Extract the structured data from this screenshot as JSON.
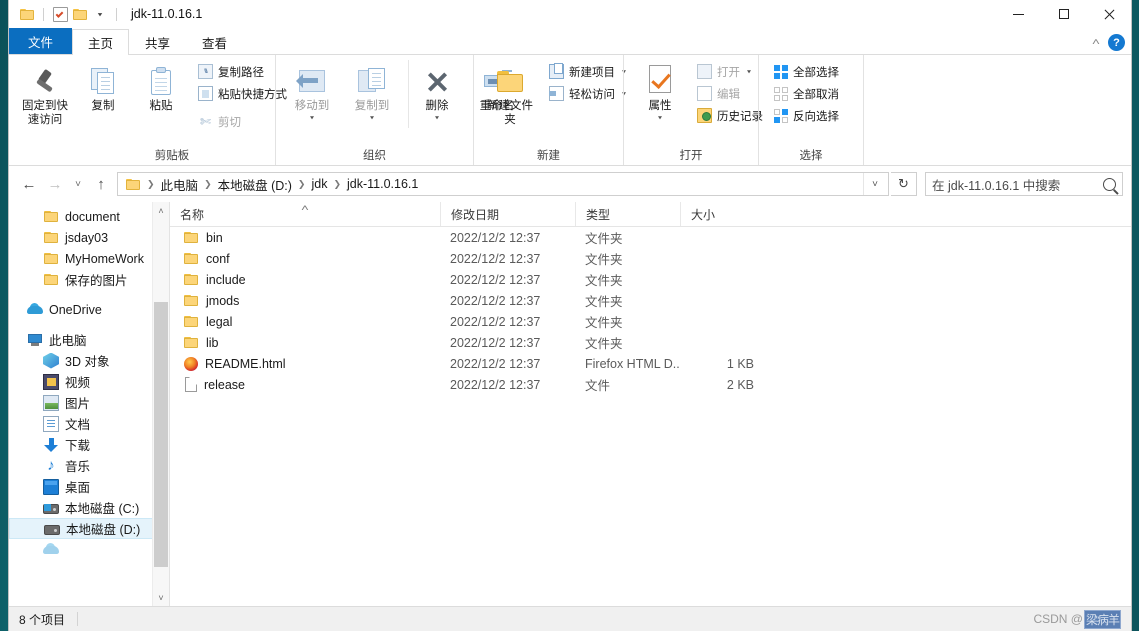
{
  "window": {
    "title": "jdk-11.0.16.1",
    "quick_access": [
      "folder-icon",
      "properties-checkbox-icon",
      "new-folder-icon",
      "customize-caret"
    ],
    "controls": {
      "minimize": "–",
      "maximize": "□",
      "close": "✕"
    }
  },
  "tabs": [
    {
      "id": "file",
      "label": "文件",
      "active": false,
      "style": "blue"
    },
    {
      "id": "home",
      "label": "主页",
      "active": true
    },
    {
      "id": "share",
      "label": "共享",
      "active": false
    },
    {
      "id": "view",
      "label": "查看",
      "active": false
    }
  ],
  "tab_right": {
    "collapse_ribbon": "˄",
    "help": "?"
  },
  "ribbon": {
    "groups": [
      {
        "label": "剪贴板",
        "big": [
          {
            "name": "pin-to-quick-access",
            "label": "固定到快速访问",
            "icon": "pin-icon"
          },
          {
            "name": "copy",
            "label": "复制",
            "icon": "copy-icon"
          },
          {
            "name": "paste",
            "label": "粘贴",
            "icon": "clipboard-icon"
          }
        ],
        "small": [
          {
            "name": "copy-path",
            "label": "复制路径",
            "icon": "path-icon"
          },
          {
            "name": "paste-shortcut",
            "label": "粘贴快捷方式",
            "icon": "shortcut-icon"
          },
          {
            "name": "cut",
            "label": "剪切",
            "icon": "scissors-icon"
          }
        ]
      },
      {
        "label": "组织",
        "big": [
          {
            "name": "move-to",
            "label": "移动到",
            "icon": "move-to-icon",
            "dropdown": true,
            "dim": true
          },
          {
            "name": "copy-to",
            "label": "复制到",
            "icon": "copy-to-icon",
            "dropdown": true,
            "dim": true
          },
          {
            "name": "delete",
            "label": "删除",
            "icon": "delete-icon",
            "dropdown": true
          },
          {
            "name": "rename",
            "label": "重命名",
            "icon": "rename-icon"
          }
        ]
      },
      {
        "label": "新建",
        "big": [
          {
            "name": "new-folder",
            "label": "新建文件夹",
            "icon": "new-folder-icon"
          }
        ],
        "small": [
          {
            "name": "new-item",
            "label": "新建项目",
            "icon": "new-item-icon",
            "dropdown": true
          },
          {
            "name": "easy-access",
            "label": "轻松访问",
            "icon": "easy-access-icon",
            "dropdown": true
          }
        ]
      },
      {
        "label": "打开",
        "big": [
          {
            "name": "properties",
            "label": "属性",
            "icon": "properties-icon",
            "dropdown": true
          }
        ],
        "small": [
          {
            "name": "open",
            "label": "打开",
            "icon": "open-icon",
            "dropdown": true,
            "dim": true
          },
          {
            "name": "edit",
            "label": "编辑",
            "icon": "edit-icon",
            "dim": true
          },
          {
            "name": "history",
            "label": "历史记录",
            "icon": "history-icon"
          }
        ]
      },
      {
        "label": "选择",
        "small": [
          {
            "name": "select-all",
            "label": "全部选择",
            "icon": "select-all-icon"
          },
          {
            "name": "select-none",
            "label": "全部取消",
            "icon": "select-none-icon"
          },
          {
            "name": "invert-selection",
            "label": "反向选择",
            "icon": "invert-selection-icon"
          }
        ]
      }
    ]
  },
  "nav": {
    "back": "←",
    "forward": "→",
    "recent": "˅",
    "up": "↑",
    "breadcrumbs": [
      "此电脑",
      "本地磁盘 (D:)",
      "jdk",
      "jdk-11.0.16.1"
    ],
    "dropdown": "˅",
    "refresh": "↻",
    "search_placeholder": "在 jdk-11.0.16.1 中搜索"
  },
  "sidebar": {
    "items": [
      {
        "label": "document",
        "icon": "folder-icon",
        "level": 2,
        "selected": false
      },
      {
        "label": "jsday03",
        "icon": "folder-icon",
        "level": 2,
        "selected": false
      },
      {
        "label": "MyHomeWork",
        "icon": "folder-icon",
        "level": 2,
        "selected": false
      },
      {
        "label": "保存的图片",
        "icon": "folder-icon",
        "level": 2,
        "selected": false
      },
      {
        "label": "OneDrive",
        "icon": "cloud-icon",
        "level": 1,
        "selected": false,
        "gap": true
      },
      {
        "label": "此电脑",
        "icon": "this-pc-icon",
        "level": 1,
        "selected": false,
        "gap": true
      },
      {
        "label": "3D 对象",
        "icon": "cube-icon",
        "level": 2,
        "selected": false
      },
      {
        "label": "视频",
        "icon": "video-icon",
        "level": 2,
        "selected": false
      },
      {
        "label": "图片",
        "icon": "pictures-icon",
        "level": 2,
        "selected": false
      },
      {
        "label": "文档",
        "icon": "documents-icon",
        "level": 2,
        "selected": false
      },
      {
        "label": "下载",
        "icon": "downloads-icon",
        "level": 2,
        "selected": false
      },
      {
        "label": "音乐",
        "icon": "music-icon",
        "level": 2,
        "selected": false
      },
      {
        "label": "桌面",
        "icon": "desktop-icon",
        "level": 2,
        "selected": false
      },
      {
        "label": "本地磁盘 (C:)",
        "icon": "system-drive-icon",
        "level": 2,
        "selected": false
      },
      {
        "label": "本地磁盘 (D:)",
        "icon": "drive-icon",
        "level": 2,
        "selected": true
      }
    ],
    "scroll": {
      "up": "˄",
      "down": "˅"
    }
  },
  "filelist": {
    "columns": [
      {
        "key": "name",
        "label": "名称",
        "sorted": "asc"
      },
      {
        "key": "modified",
        "label": "修改日期"
      },
      {
        "key": "type",
        "label": "类型"
      },
      {
        "key": "size",
        "label": "大小"
      }
    ],
    "sort_indicator": "˄",
    "rows": [
      {
        "name": "bin",
        "modified": "2022/12/2 12:37",
        "type": "文件夹",
        "size": "",
        "icon": "folder-icon"
      },
      {
        "name": "conf",
        "modified": "2022/12/2 12:37",
        "type": "文件夹",
        "size": "",
        "icon": "folder-icon"
      },
      {
        "name": "include",
        "modified": "2022/12/2 12:37",
        "type": "文件夹",
        "size": "",
        "icon": "folder-icon"
      },
      {
        "name": "jmods",
        "modified": "2022/12/2 12:37",
        "type": "文件夹",
        "size": "",
        "icon": "folder-icon"
      },
      {
        "name": "legal",
        "modified": "2022/12/2 12:37",
        "type": "文件夹",
        "size": "",
        "icon": "folder-icon"
      },
      {
        "name": "lib",
        "modified": "2022/12/2 12:37",
        "type": "文件夹",
        "size": "",
        "icon": "folder-icon"
      },
      {
        "name": "README.html",
        "modified": "2022/12/2 12:37",
        "type": "Firefox HTML D...",
        "size": "1 KB",
        "icon": "firefox-icon"
      },
      {
        "name": "release",
        "modified": "2022/12/2 12:37",
        "type": "文件",
        "size": "2 KB",
        "icon": "file-icon"
      }
    ]
  },
  "status": {
    "item_count": "8 个项目"
  },
  "watermark": {
    "prefix": "CSDN @",
    "handle": "梁病羊"
  },
  "colors": {
    "accent": "#0b6ec0",
    "selection": "#e5f3fb",
    "folder": "#fcd579",
    "desktop": "#0d5f68"
  }
}
